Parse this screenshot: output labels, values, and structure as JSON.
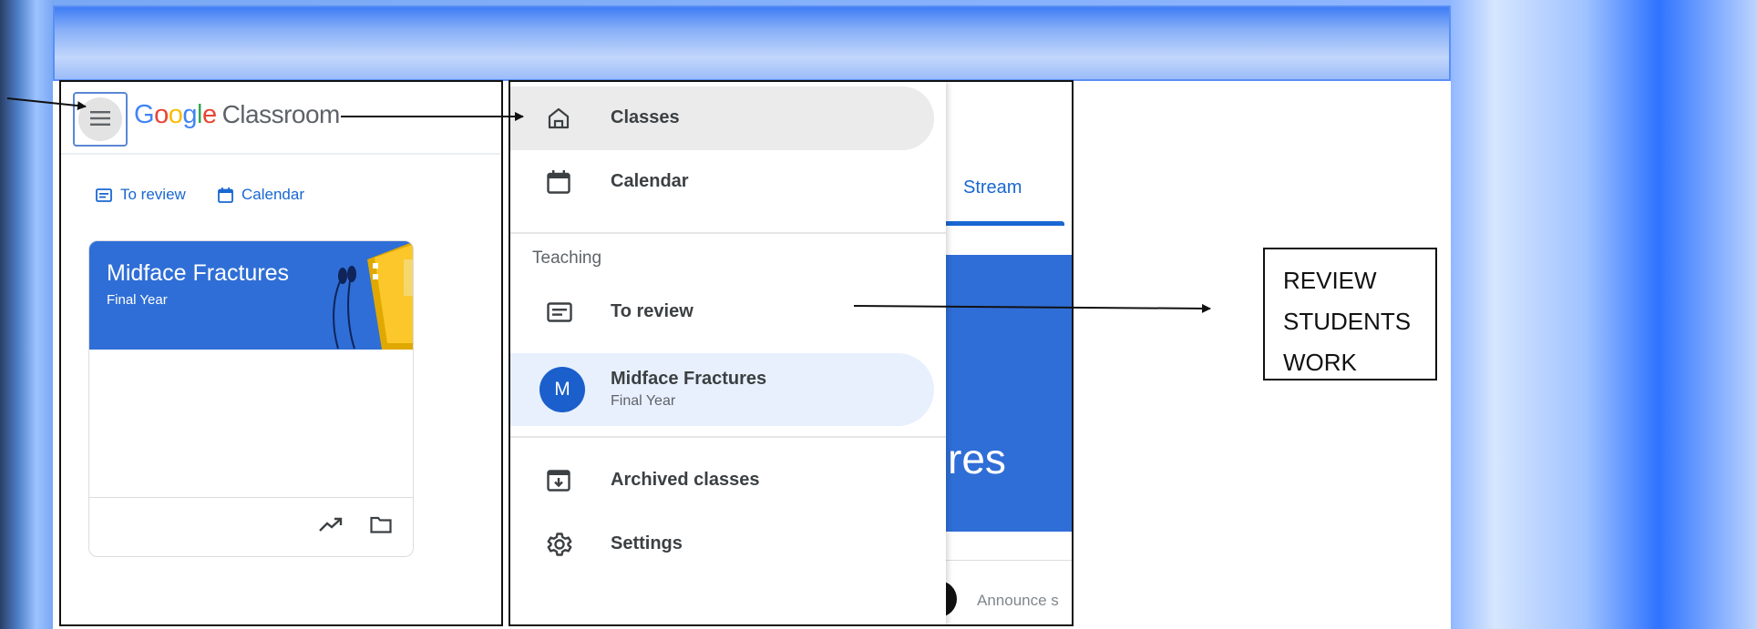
{
  "classroom": {
    "logo_letters": [
      "G",
      "o",
      "o",
      "g",
      "l",
      "e"
    ],
    "logo_product": "Classroom",
    "to_review_label": "To review",
    "calendar_label": "Calendar",
    "card_title": "Midface Fractures",
    "card_subtitle": "Final Year"
  },
  "drawer": {
    "classes_label": "Classes",
    "calendar_label": "Calendar",
    "section_teaching": "Teaching",
    "to_review_label": "To review",
    "course_initial": "M",
    "course_name": "Midface Fractures",
    "course_subtitle": "Final Year",
    "archived_label": "Archived classes",
    "settings_label": "Settings"
  },
  "background_page": {
    "stream_tab": "Stream",
    "banner_text_fragment": "res",
    "announce_fragment": "Announce s"
  },
  "callout": {
    "lines": [
      "REVIEW",
      "STUDENTS",
      "WORK"
    ]
  },
  "colors": {
    "google_blue": "#1967d2",
    "course_banner": "#2f6ed6",
    "active_nav": "#ebebeb",
    "course_highlight": "#e8f0fe"
  }
}
